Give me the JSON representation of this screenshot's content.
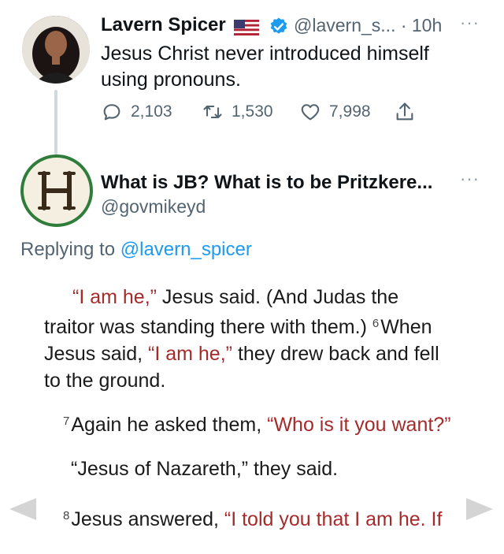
{
  "tweet1": {
    "author_name": "Lavern Spicer",
    "handle_time": "@lavern_s... · 10h",
    "text": "Jesus Christ never introduced himself using pronouns.",
    "replies": "2,103",
    "retweets": "1,530",
    "likes": "7,998",
    "more": "···"
  },
  "tweet2": {
    "author_name": "What is JB? What is to be Pritzkere...",
    "handle": "@govmikeyd",
    "more": "···",
    "replying_prefix": "Replying to ",
    "replying_handle": "@lavern_spicer"
  },
  "passage": {
    "p1_q1": "“I am he,”",
    "p1_t1": " Jesus said. (And Judas the traitor was standing there with them.) ",
    "p1_v6": "6",
    "p1_t2": "When Jesus said, ",
    "p1_q2": "“I am he,”",
    "p1_t3": " they drew back and fell to the ground.",
    "p2_v7": "7",
    "p2_t1": "Again he asked them, ",
    "p2_q1": "“Who is it you want?”",
    "p3_t1": "“Jesus of Nazareth,” they said.",
    "p4_v8": "8",
    "p4_t1": "Jesus answered, ",
    "p4_q1": "“I told you that I am he. If"
  },
  "icons": {
    "flag": "us-flag-icon",
    "verified": "verified-badge-icon",
    "reply": "reply-icon",
    "retweet": "retweet-icon",
    "like": "heart-icon",
    "share": "share-icon"
  },
  "colors": {
    "link": "#1d9bf0",
    "secondary": "#536471",
    "red_letter": "#a52a2a"
  }
}
